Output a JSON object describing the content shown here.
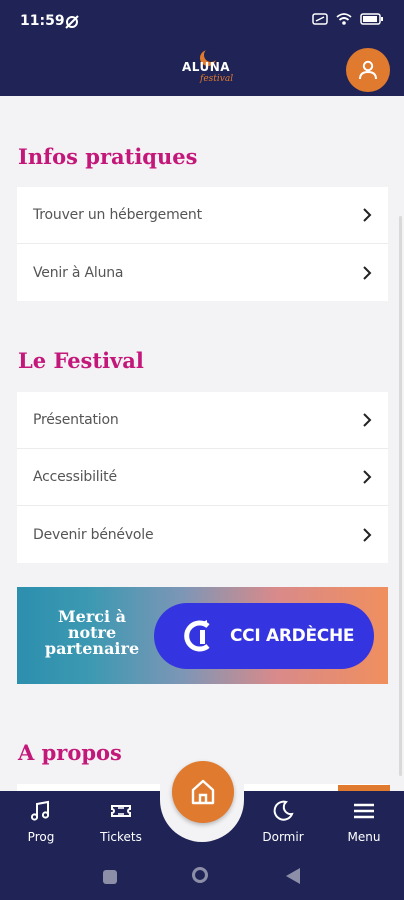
{
  "status_bar": {
    "time": "11:59"
  },
  "header": {
    "logo_text": "ALUNA",
    "logo_sub": "festival"
  },
  "sections": [
    {
      "title": "Infos pratiques",
      "items": [
        "Trouver un hébergement",
        "Venir à Aluna"
      ]
    },
    {
      "title": "Le Festival",
      "items": [
        "Présentation",
        "Accessibilité",
        "Devenir bénévole"
      ]
    },
    {
      "title": "A propos",
      "items": []
    }
  ],
  "banner": {
    "line1": "Merci à",
    "line2": "notre",
    "line3": "partenaire",
    "partner": "CCI ARDÈCHE"
  },
  "bottom_nav": [
    {
      "label": "Prog",
      "icon": "music-note-icon"
    },
    {
      "label": "Tickets",
      "icon": "ticket-icon"
    },
    {
      "label": "Dormir",
      "icon": "moon-icon"
    },
    {
      "label": "Menu",
      "icon": "menu-icon"
    }
  ],
  "colors": {
    "nav_bg": "#1f2355",
    "accent": "#e07a2e",
    "section_title": "#c4177a",
    "partner_blue": "#3434e0"
  }
}
